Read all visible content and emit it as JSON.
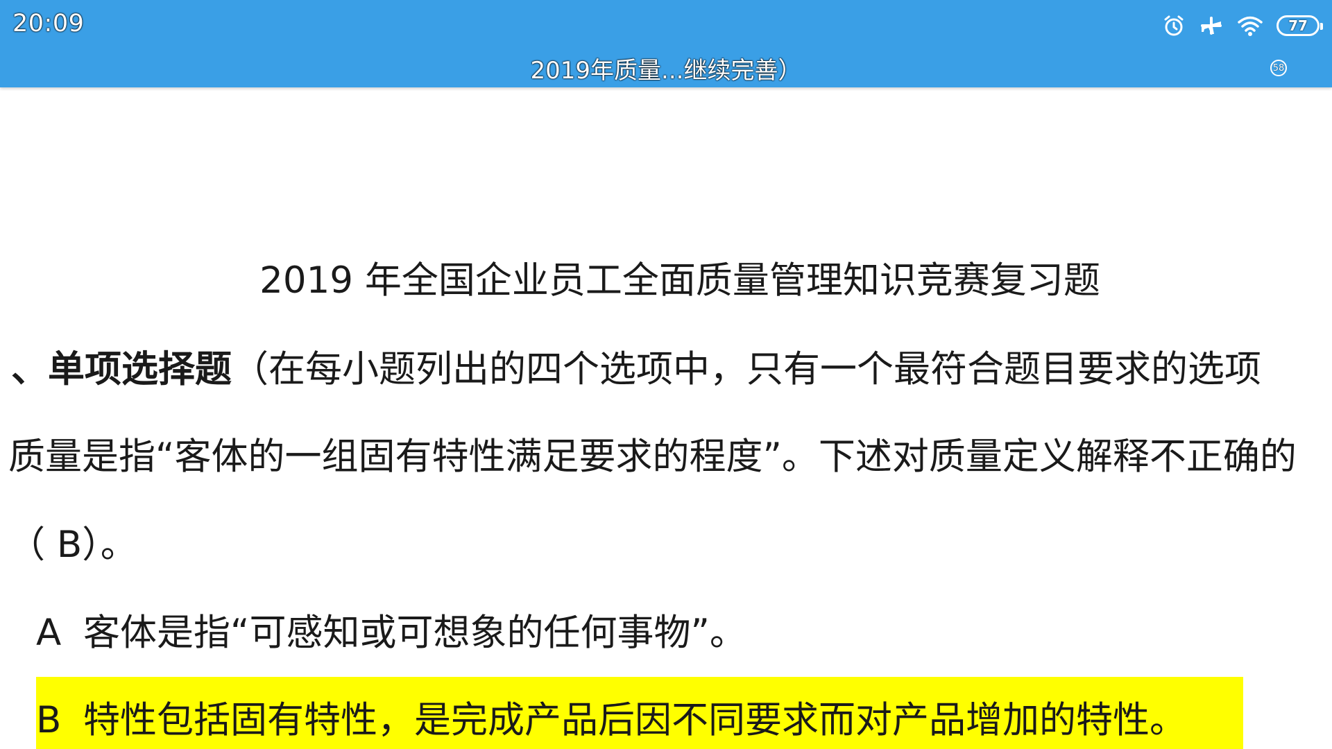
{
  "status_bar": {
    "time": "20:09",
    "battery": "77",
    "icons": [
      "alarm-icon",
      "airplane-icon",
      "wifi-icon",
      "battery-icon"
    ]
  },
  "app_bar": {
    "title": "2019年质量...继续完善）",
    "page_badge": "58"
  },
  "document": {
    "heading": "2019 年全国企业员工全面质量管理知识竞赛复习题",
    "section_prefix": "、",
    "section_title": "单项选择题",
    "section_note": "（在每小题列出的四个选项中，只有一个最符合题目要求的选项",
    "question": "质量是指“客体的一组固有特性满足要求的程度”。下述对质量定义解释不正确的",
    "answer_line": "（  B）。",
    "options": [
      {
        "letter": "A",
        "text": "客体是指“可感知或可想象的任何事物”。"
      },
      {
        "letter": "B",
        "text": "特性包括固有特性，是完成产品后因不同要求而对产品增加的特性。"
      }
    ],
    "highlight_color": "#ffff00"
  },
  "colors": {
    "app_bar": "#3a9fe6",
    "text": "#1a1a1a",
    "background": "#ffffff"
  }
}
